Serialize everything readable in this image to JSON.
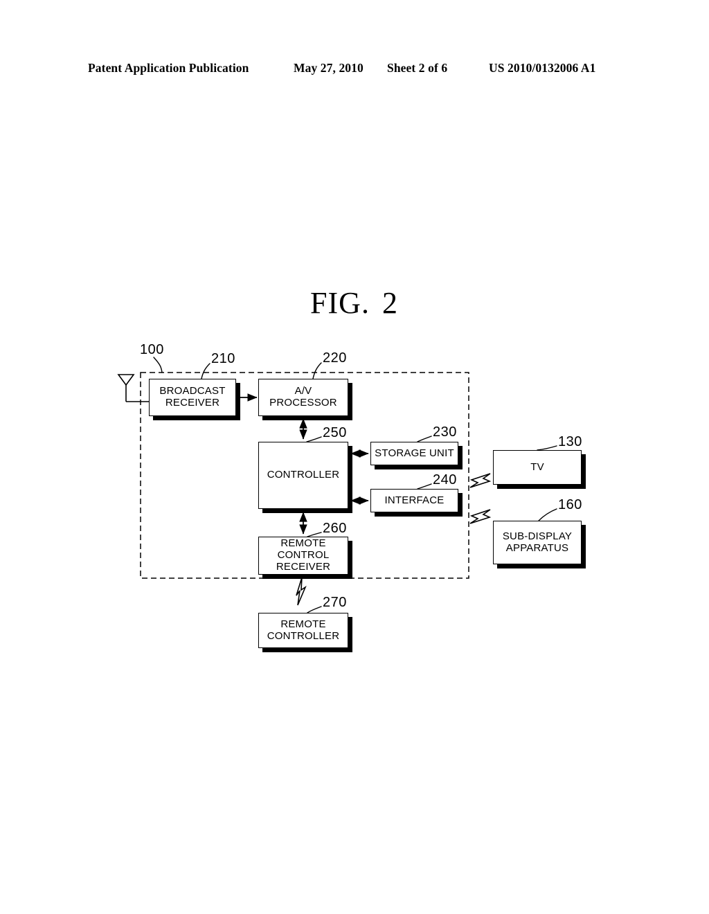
{
  "header": {
    "publication": "Patent Application Publication",
    "date": "May 27, 2010",
    "sheet": "Sheet 2 of 6",
    "patent_number": "US 2010/0132006 A1"
  },
  "figure": {
    "label": "FIG.",
    "number": "2"
  },
  "blocks": [
    {
      "id": "broadcast_receiver",
      "ref": "210",
      "lines": [
        "BROADCAST",
        "RECEIVER"
      ]
    },
    {
      "id": "av_processor",
      "ref": "220",
      "lines": [
        "A/V",
        "PROCESSOR"
      ]
    },
    {
      "id": "controller",
      "ref": "250",
      "lines": [
        "CONTROLLER"
      ]
    },
    {
      "id": "storage_unit",
      "ref": "230",
      "lines": [
        "STORAGE UNIT"
      ]
    },
    {
      "id": "interface",
      "ref": "240",
      "lines": [
        "INTERFACE"
      ]
    },
    {
      "id": "rc_receiver",
      "ref": "260",
      "lines": [
        "REMOTE",
        "CONTROL",
        "RECEIVER"
      ]
    },
    {
      "id": "remote_controller",
      "ref": "270",
      "lines": [
        "REMOTE",
        "CONTROLLER"
      ]
    },
    {
      "id": "tv",
      "ref": "130",
      "lines": [
        "TV"
      ]
    },
    {
      "id": "sub_display",
      "ref": "160",
      "lines": [
        "SUB-DISPLAY",
        "APPARATUS"
      ]
    }
  ],
  "references": {
    "system_boundary": "100",
    "broadcast_receiver": "210",
    "av_processor": "220",
    "storage_unit": "230",
    "interface": "240",
    "controller": "250",
    "rc_receiver": "260",
    "remote_controller": "270",
    "tv": "130",
    "sub_display": "160"
  },
  "connections": [
    {
      "from": "antenna",
      "to": "broadcast_receiver",
      "style": "line"
    },
    {
      "from": "broadcast_receiver",
      "to": "av_processor",
      "style": "arrow"
    },
    {
      "from": "av_processor",
      "to": "controller",
      "style": "double-arrow"
    },
    {
      "from": "controller",
      "to": "storage_unit",
      "style": "double-arrow"
    },
    {
      "from": "controller",
      "to": "interface",
      "style": "double-arrow"
    },
    {
      "from": "controller",
      "to": "rc_receiver",
      "style": "double-arrow"
    },
    {
      "from": "interface",
      "to": "tv",
      "style": "wireless"
    },
    {
      "from": "interface",
      "to": "sub_display",
      "style": "wireless"
    },
    {
      "from": "remote_controller",
      "to": "rc_receiver",
      "style": "wireless"
    }
  ],
  "colors": {
    "ink": "#000000",
    "paper": "#ffffff"
  },
  "icons": {
    "antenna": "antenna-icon",
    "wireless": "lightning-bolt-icon"
  }
}
